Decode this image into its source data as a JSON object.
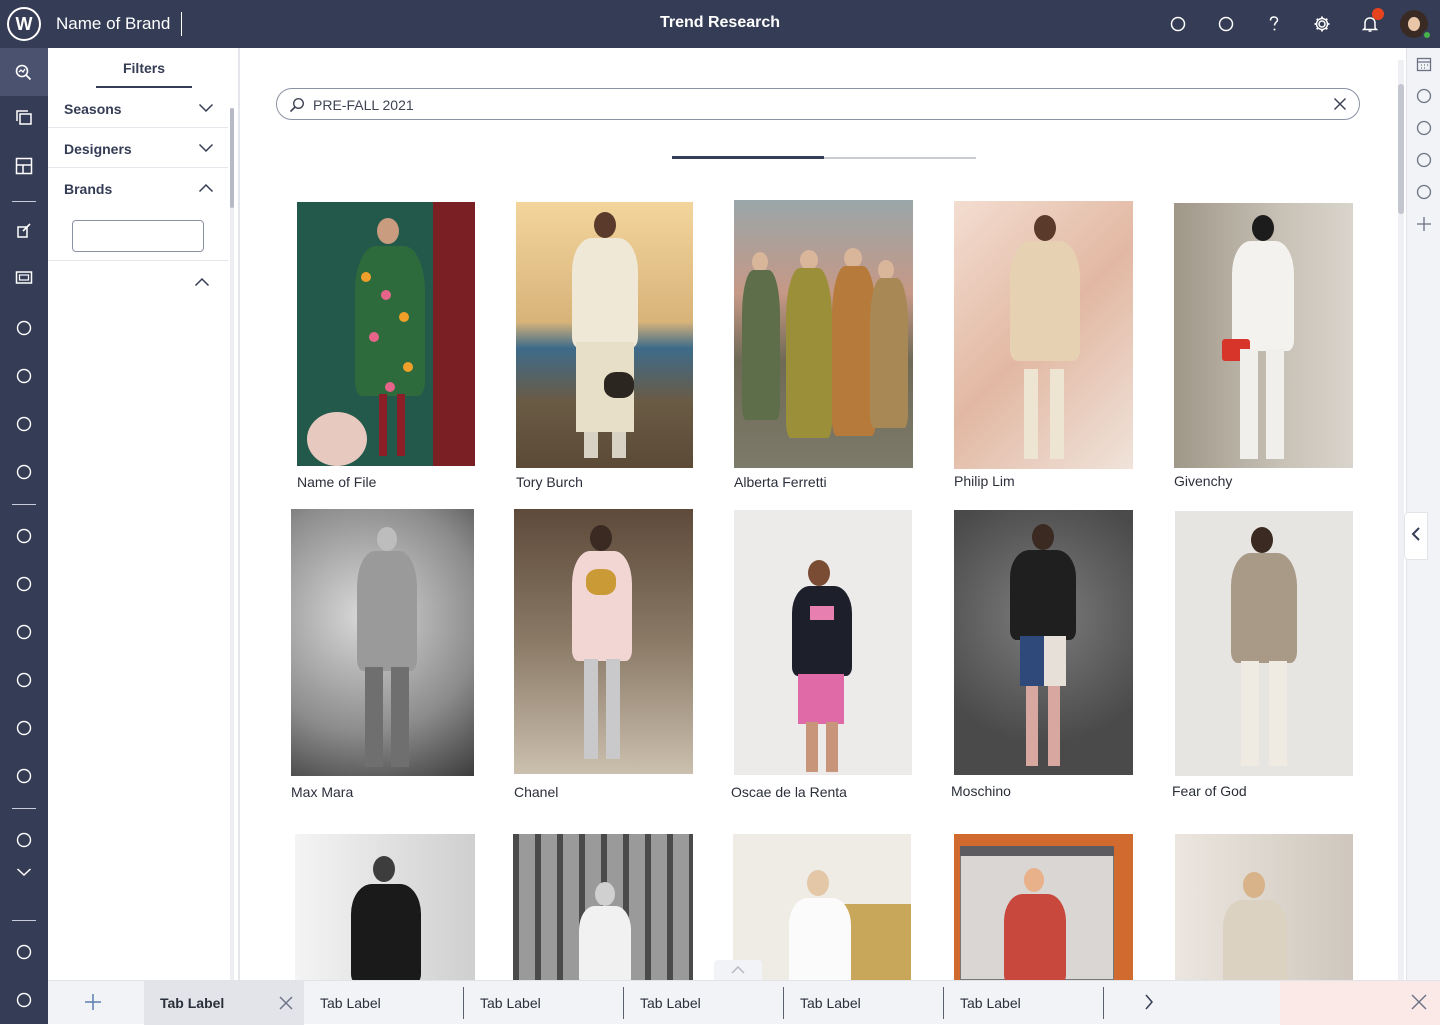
{
  "app": {
    "logo_letter": "W",
    "brand_name": "Name of Brand",
    "page_title": "Trend Research"
  },
  "topbar": {
    "icons": [
      "circle-icon",
      "circle-icon",
      "help-icon",
      "gear-icon",
      "bell-icon"
    ],
    "notification_color": "#e8431f"
  },
  "left_rail": {
    "items": [
      "trend-search-icon",
      "layers-icon",
      "layout-icon",
      "edit-icon",
      "slideshow-icon",
      "circle-icon",
      "circle-icon",
      "circle-icon",
      "circle-icon",
      "circle-icon",
      "circle-icon",
      "circle-icon",
      "circle-icon",
      "circle-icon",
      "circle-icon",
      "circle-icon",
      "chevron-down-icon",
      "circle-icon",
      "circle-icon"
    ]
  },
  "filters": {
    "title": "Filters",
    "sections": [
      {
        "label": "Seasons",
        "expanded": false
      },
      {
        "label": "Designers",
        "expanded": false
      },
      {
        "label": "Brands",
        "expanded": true
      }
    ],
    "brand_input_value": ""
  },
  "search": {
    "value": "PRE-FALL 2021"
  },
  "gallery": {
    "items": [
      {
        "caption": "Name of File"
      },
      {
        "caption": "Tory Burch"
      },
      {
        "caption": "Alberta Ferretti"
      },
      {
        "caption": "Philip Lim"
      },
      {
        "caption": "Givenchy"
      },
      {
        "caption": "Max Mara"
      },
      {
        "caption": "Chanel"
      },
      {
        "caption": "Oscae de la Renta"
      },
      {
        "caption": "Moschino"
      },
      {
        "caption": "Fear of God"
      },
      {
        "caption": ""
      },
      {
        "caption": ""
      },
      {
        "caption": ""
      },
      {
        "caption": ""
      },
      {
        "caption": ""
      }
    ]
  },
  "right_rail": {
    "items": [
      "calendar-icon",
      "circle-icon",
      "circle-icon",
      "circle-icon",
      "circle-icon",
      "plus-icon"
    ]
  },
  "bottom_tabs": {
    "tabs": [
      {
        "label": "Tab Label",
        "active": true
      },
      {
        "label": "Tab Label",
        "active": false
      },
      {
        "label": "Tab Label",
        "active": false
      },
      {
        "label": "Tab Label",
        "active": false
      },
      {
        "label": "Tab Label",
        "active": false
      },
      {
        "label": "Tab Label",
        "active": false
      }
    ]
  },
  "colors": {
    "nav_bg": "#353c55",
    "accent": "#353c55",
    "alert": "#e8431f",
    "online": "#48b34a"
  }
}
